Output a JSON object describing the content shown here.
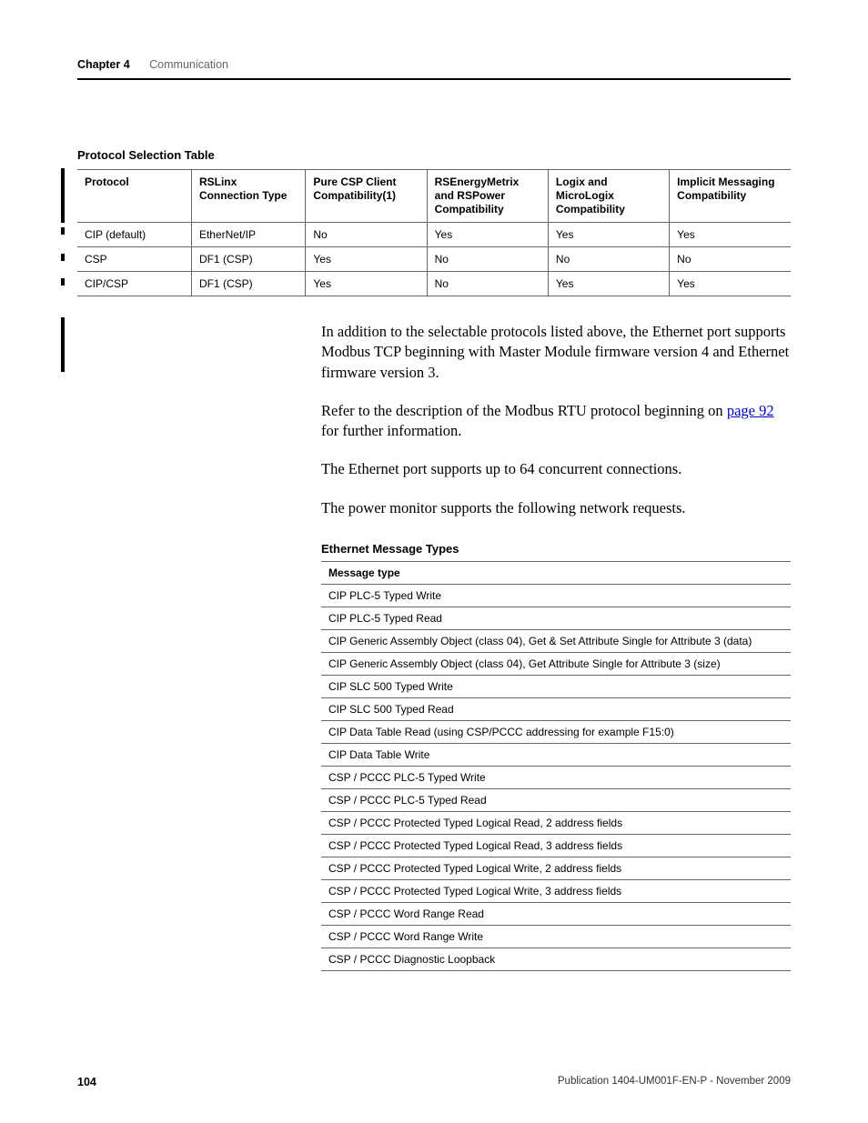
{
  "header": {
    "chapter": "Chapter 4",
    "title": "Communication"
  },
  "protocol_table": {
    "title": "Protocol Selection Table",
    "columns": [
      "Protocol",
      "RSLinx Connection Type",
      "Pure CSP Client Compatibility(1)",
      "RSEnergyMetrix and RSPower Compatibility",
      "Logix and MicroLogix Compatibility",
      "Implicit Messaging Compatibility"
    ],
    "rows": [
      [
        "CIP (default)",
        "EtherNet/IP",
        "No",
        "Yes",
        "Yes",
        "Yes"
      ],
      [
        "CSP",
        "DF1 (CSP)",
        "Yes",
        "No",
        "No",
        "No"
      ],
      [
        "CIP/CSP",
        "DF1 (CSP)",
        "Yes",
        "No",
        "Yes",
        "Yes"
      ]
    ]
  },
  "body": {
    "p1": "In addition to the selectable protocols listed above, the Ethernet port supports Modbus TCP beginning with Master Module firmware version 4 and Ethernet firmware version 3.",
    "p2_a": "Refer to the description of the Modbus RTU protocol beginning on ",
    "p2_link": "page 92",
    "p2_b": " for further information.",
    "p3": "The Ethernet port supports up to 64 concurrent connections.",
    "p4": "The power monitor supports the following network requests."
  },
  "message_table": {
    "title": "Ethernet Message Types",
    "header": "Message type",
    "rows": [
      "CIP PLC-5 Typed Write",
      "CIP PLC-5 Typed Read",
      "CIP Generic Assembly Object (class 04), Get & Set Attribute Single for Attribute 3 (data)",
      "CIP Generic Assembly Object (class 04), Get Attribute Single for Attribute 3 (size)",
      "CIP SLC 500 Typed Write",
      "CIP SLC 500 Typed Read",
      "CIP Data Table Read (using CSP/PCCC addressing for example F15:0)",
      "CIP Data Table Write",
      "CSP / PCCC PLC-5 Typed Write",
      "CSP / PCCC  PLC-5 Typed Read",
      "CSP / PCCC Protected Typed Logical Read, 2 address fields",
      "CSP / PCCC Protected Typed Logical Read, 3 address fields",
      "CSP / PCCC Protected Typed Logical Write, 2 address fields",
      "CSP / PCCC Protected Typed Logical Write, 3 address fields",
      "CSP / PCCC Word Range Read",
      "CSP / PCCC Word Range Write",
      "CSP / PCCC Diagnostic Loopback"
    ]
  },
  "footer": {
    "page": "104",
    "publication": "Publication 1404-UM001F-EN-P - November 2009"
  }
}
